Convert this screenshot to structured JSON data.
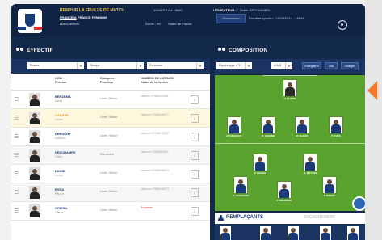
{
  "header": {
    "title": "REMPLIR LA FEUILLE DE MATCH",
    "subtitle_1": "FRANCE/A",
    "subtitle_2": "FRANCE FEMININE",
    "sub_3": "Match amical",
    "meta": "10/08/2014 à 19h00",
    "meta_2": "Durée : 90'",
    "meta_3": "Stade de France",
    "user_label": "UTILISATEUR :",
    "user": "Didier DESCHAMPS",
    "user_btn": "Déconnexion",
    "last_save": "Dernière synchro : 10/08/2014 - 18h44",
    "settings_icon": "gear-icon"
  },
  "effectif": {
    "title": "EFFECTIF",
    "filters": [
      "Postes",
      "Groupe",
      "Personne"
    ],
    "columns": {
      "name": "NOM\nPrénom",
      "category": "Catégorie\nFonction",
      "license": "NUMÉRO DE LICENCE\nStatut de la licence"
    },
    "players": [
      {
        "name": "BENZEMA",
        "first": "Karim",
        "cat": "Libre / Sénior",
        "lic": "Licence n°2360024561",
        "lic_red": false
      },
      {
        "name": "CABAYE",
        "first": "Yohan",
        "cat": "Libre / Sénior",
        "lic": "Licence n°2260045072",
        "lic_red": false,
        "selected": true
      },
      {
        "name": "DEBUCHY",
        "first": "Mathieu",
        "cat": "Libre / Sénior",
        "lic": "Licence n°2345672012",
        "lic_red": false
      },
      {
        "name": "DESCHAMPS",
        "first": "Didier",
        "cat": "Entraîneur",
        "lic": "Licence n°2360024507",
        "lic_red": false
      },
      {
        "name": "DIGNE",
        "first": "Lucas",
        "cat": "Libre / Sénior",
        "lic": "Licence n°2360045074",
        "lic_red": false
      },
      {
        "name": "EVRA",
        "first": "Patrice",
        "cat": "Libre / Sénior",
        "lic": "Licence n°2360045073",
        "lic_red": false
      },
      {
        "name": "GRIZOU",
        "first": "Olivier",
        "cat": "Libre / Sénior",
        "lic": "Suspendu",
        "lic_red": true
      }
    ]
  },
  "composition": {
    "title": "COMPOSITION",
    "select_1": "Equipe type n°1",
    "select_2": "4-3-3",
    "buttons": [
      "Enregistrer",
      "Voir",
      "Charger"
    ],
    "pitch_players": [
      "H. LLORIS",
      "M. DEBUCHY",
      "R. VARANE",
      "M. SAKHO",
      "P. EVRA",
      "P. POGBA",
      "B. MATUIDI",
      "M. VALBUENA",
      "K. BENZEMA",
      "F. RIBERY"
    ],
    "remplacants": "REMPLAÇANTS",
    "encadrement": "ENCADREMENT"
  }
}
